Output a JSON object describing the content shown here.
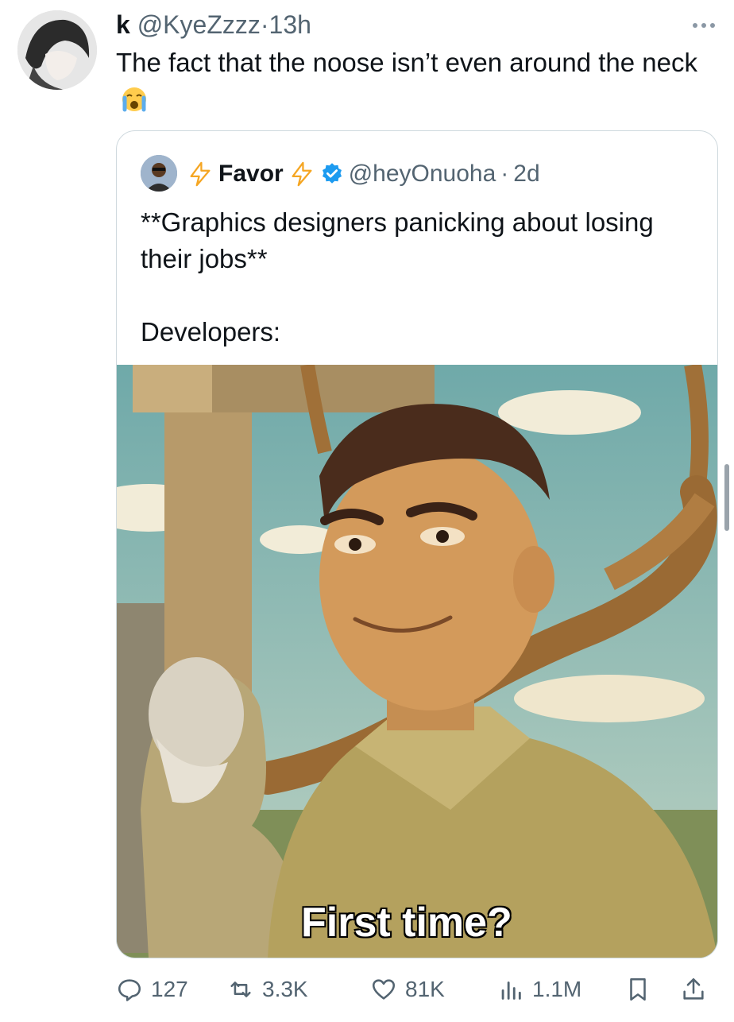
{
  "tweet": {
    "display_name": "k",
    "handle": "@KyeZzzz",
    "separator": "·",
    "time": "13h",
    "text": "The fact that the noose isn’t even around the neck",
    "emoji_icon": "loudly-crying-face-icon"
  },
  "quoted": {
    "display_name": "Favor",
    "handle": "@heyOnuoha",
    "separator": "·",
    "time": "2d",
    "line1": "**Graphics designers panicking about losing their jobs**",
    "line2": "Developers:",
    "verified_color": "#1d9bf0",
    "bolt_color": "#f5a623"
  },
  "media": {
    "caption": "First time?"
  },
  "actions": {
    "replies": "127",
    "reposts": "3.3K",
    "likes": "81K",
    "views": "1.1M"
  }
}
